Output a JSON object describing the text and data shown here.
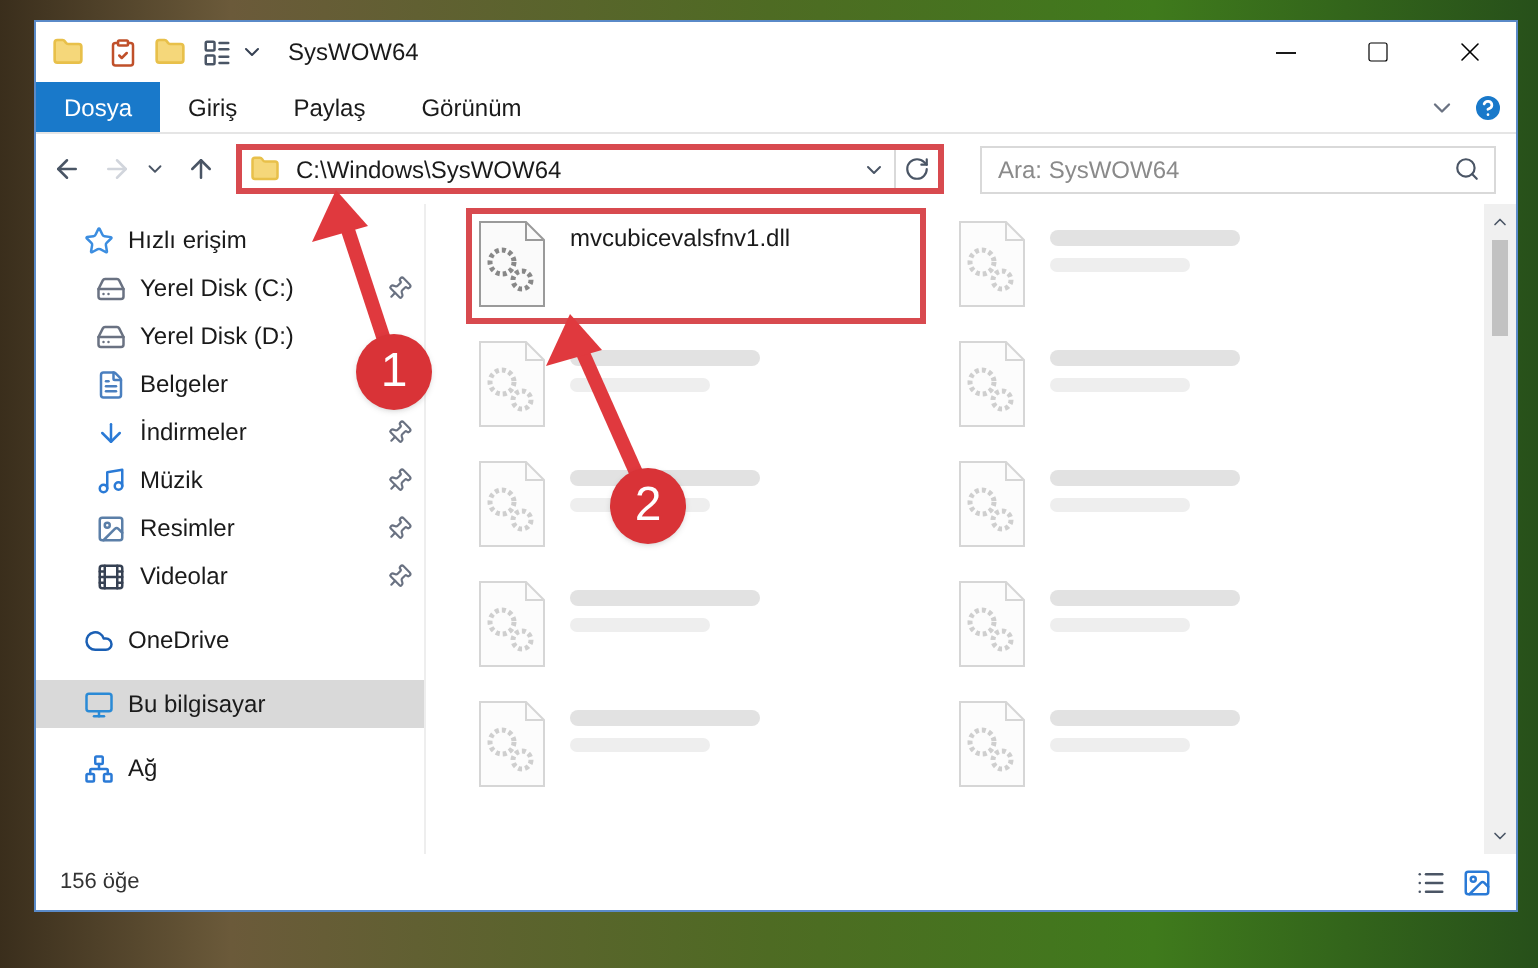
{
  "window": {
    "title": "SysWOW64"
  },
  "ribbon_tabs": [
    {
      "label": "Dosya",
      "selected": true
    },
    {
      "label": "Giriş",
      "selected": false
    },
    {
      "label": "Paylaş",
      "selected": false
    },
    {
      "label": "Görünüm",
      "selected": false
    }
  ],
  "address_bar": {
    "path": "C:\\Windows\\SysWOW64",
    "highlighted": true
  },
  "search": {
    "placeholder": "Ara: SysWOW64"
  },
  "sidebar": {
    "items": [
      {
        "label": "Hızlı erişim",
        "kind": "star",
        "selected": false,
        "children": [
          {
            "label": "Yerel Disk (C:)",
            "kind": "drive",
            "pinned": true,
            "selected": false
          },
          {
            "label": "Yerel Disk (D:)",
            "kind": "drive",
            "pinned": false,
            "selected": false
          },
          {
            "label": "Belgeler",
            "kind": "document",
            "pinned": false,
            "selected": false
          },
          {
            "label": "İndirmeler",
            "kind": "download",
            "pinned": true,
            "selected": false
          },
          {
            "label": "Müzik",
            "kind": "music",
            "pinned": true,
            "selected": false
          },
          {
            "label": "Resimler",
            "kind": "picture",
            "pinned": true,
            "selected": false
          },
          {
            "label": "Videolar",
            "kind": "video",
            "pinned": true,
            "selected": false
          }
        ]
      },
      {
        "label": "OneDrive",
        "kind": "cloud",
        "selected": false
      },
      {
        "label": "Bu bilgisayar",
        "kind": "computer",
        "selected": true
      },
      {
        "label": "Ağ",
        "kind": "network",
        "selected": false
      }
    ]
  },
  "files": [
    {
      "name": "mvcubicevalsfnv1.dll",
      "blurred": false,
      "highlighted": true
    },
    {
      "blurred": true,
      "highlighted": false
    },
    {
      "blurred": true,
      "highlighted": false
    },
    {
      "blurred": true,
      "highlighted": false
    },
    {
      "blurred": true,
      "highlighted": false
    },
    {
      "blurred": true,
      "highlighted": false
    },
    {
      "blurred": true,
      "highlighted": false
    },
    {
      "blurred": true,
      "highlighted": false
    },
    {
      "blurred": true,
      "highlighted": false
    },
    {
      "blurred": true,
      "highlighted": false
    }
  ],
  "status_bar": {
    "item_count": "156 öğe"
  },
  "annotations": [
    {
      "label": "1"
    },
    {
      "label": "2"
    }
  ]
}
